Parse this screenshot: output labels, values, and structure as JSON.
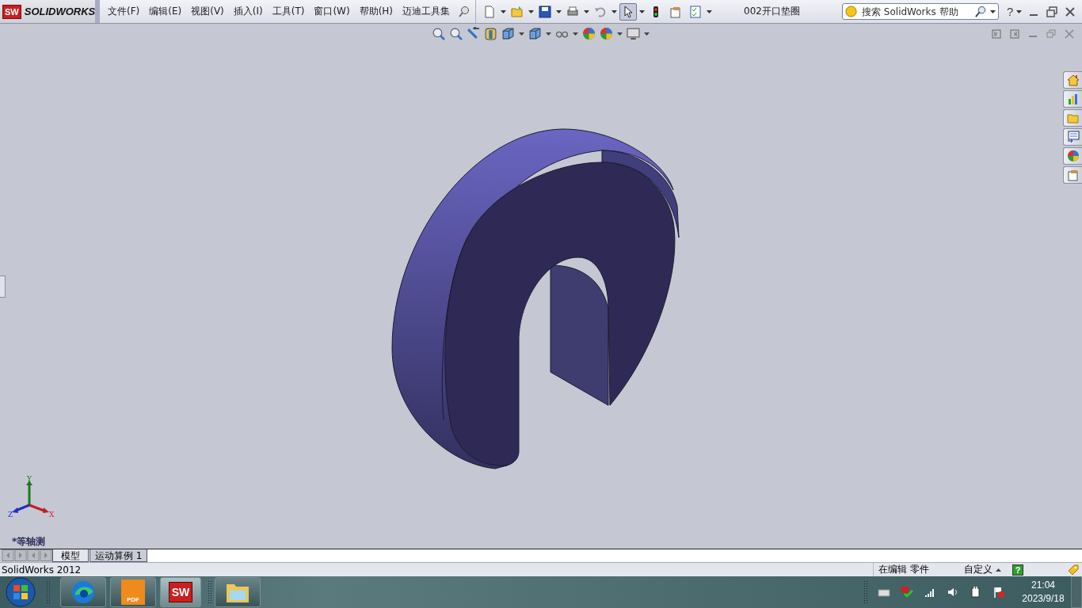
{
  "app": {
    "logo_mark": "SW",
    "logo": "SOLIDWORKS"
  },
  "menu": [
    "文件(F)",
    "编辑(E)",
    "视图(V)",
    "插入(I)",
    "工具(T)",
    "窗口(W)",
    "帮助(H)",
    "迈迪工具集"
  ],
  "document_title": "002开口垫圈",
  "search": {
    "placeholder": "搜索 SolidWorks 帮助"
  },
  "help_button": "?",
  "viewport": {
    "view_name": "*等轴测",
    "triad": {
      "x": "X",
      "y": "Y",
      "z": "Z"
    }
  },
  "tabs": [
    {
      "label": "模型",
      "selected": true
    },
    {
      "label": "运动算例 1",
      "selected": false
    }
  ],
  "status_bar": {
    "app_version": "SolidWorks 2012",
    "edit_state": "在编辑 零件",
    "units": "自定义",
    "help": "?"
  },
  "taskbar": {
    "apps": [
      {
        "kind": "edge"
      },
      {
        "kind": "pdf",
        "label": "PDF"
      },
      {
        "kind": "solidworks",
        "label": "SW"
      },
      {
        "kind": "folder"
      }
    ],
    "time": "21:04",
    "date": "2023/9/18"
  }
}
